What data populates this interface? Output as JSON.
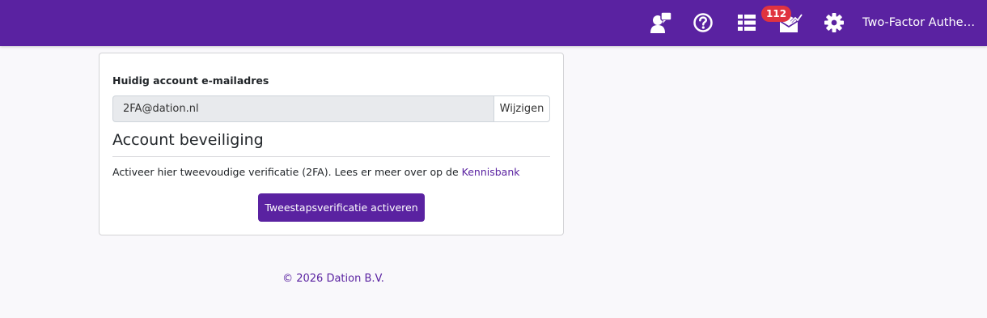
{
  "header": {
    "icons": [
      {
        "name": "support-chat-icon"
      },
      {
        "name": "help-icon"
      },
      {
        "name": "list-icon"
      },
      {
        "name": "mail-notifications-icon"
      },
      {
        "name": "gear-icon"
      }
    ],
    "notification_count": "112",
    "user_label": "Two-Factor Authentication",
    "bar_color": "#5a22a1",
    "badge_color": "#e0333f"
  },
  "account": {
    "email_label": "Huidig account e-mailadres",
    "email_value": "2FA@dation.nl",
    "change_button": "Wijzigen"
  },
  "security": {
    "title": "Account beveiliging",
    "description": "Activeer hier tweevoudige verificatie (2FA). Lees er meer over op de",
    "link_text": "Kennisbank",
    "activate_button": "Tweestapsverificatie activeren"
  },
  "footer": {
    "copyright": "© 2026 Dation B.V."
  }
}
